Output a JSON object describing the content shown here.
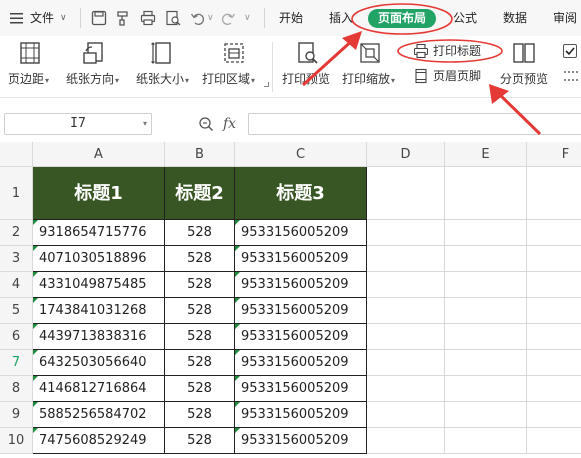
{
  "menu": {
    "file_label": "文件",
    "tabs": [
      "开始",
      "插入",
      "页面布局",
      "公式",
      "数据",
      "审阅"
    ],
    "active_tab": "页面布局"
  },
  "ribbon": {
    "margins": "页边距",
    "orientation": "纸张方向",
    "size": "纸张大小",
    "print_area": "打印区域",
    "print_preview": "打印预览",
    "print_scale": "打印缩放",
    "print_titles": "打印标题",
    "header_footer": "页眉页脚",
    "page_break_preview": "分页预览"
  },
  "formula_bar": {
    "name_box": "I7",
    "fx_label": "fx",
    "formula": ""
  },
  "sheet": {
    "columns": [
      "A",
      "B",
      "C",
      "D",
      "E",
      "F"
    ],
    "active_row": 7,
    "header_row": [
      "标题1",
      "标题2",
      "标题3"
    ],
    "rows": [
      {
        "n": "2",
        "a": "9318654715776",
        "b": "528",
        "c": "9533156005209"
      },
      {
        "n": "3",
        "a": "4071030518896",
        "b": "528",
        "c": "9533156005209"
      },
      {
        "n": "4",
        "a": "4331049875485",
        "b": "528",
        "c": "9533156005209"
      },
      {
        "n": "5",
        "a": "1743841031268",
        "b": "528",
        "c": "9533156005209"
      },
      {
        "n": "6",
        "a": "4439713838316",
        "b": "528",
        "c": "9533156005209"
      },
      {
        "n": "7",
        "a": "6432503056640",
        "b": "528",
        "c": "9533156005209"
      },
      {
        "n": "8",
        "a": "4146812716864",
        "b": "528",
        "c": "9533156005209"
      },
      {
        "n": "9",
        "a": "5885256584702",
        "b": "528",
        "c": "9533156005209"
      },
      {
        "n": "10",
        "a": "7475608529249",
        "b": "528",
        "c": "9533156005209"
      }
    ],
    "row1_number": "1"
  },
  "colors": {
    "accent": "#21a366",
    "header_fill": "#375623",
    "annotation": "#e53935"
  }
}
